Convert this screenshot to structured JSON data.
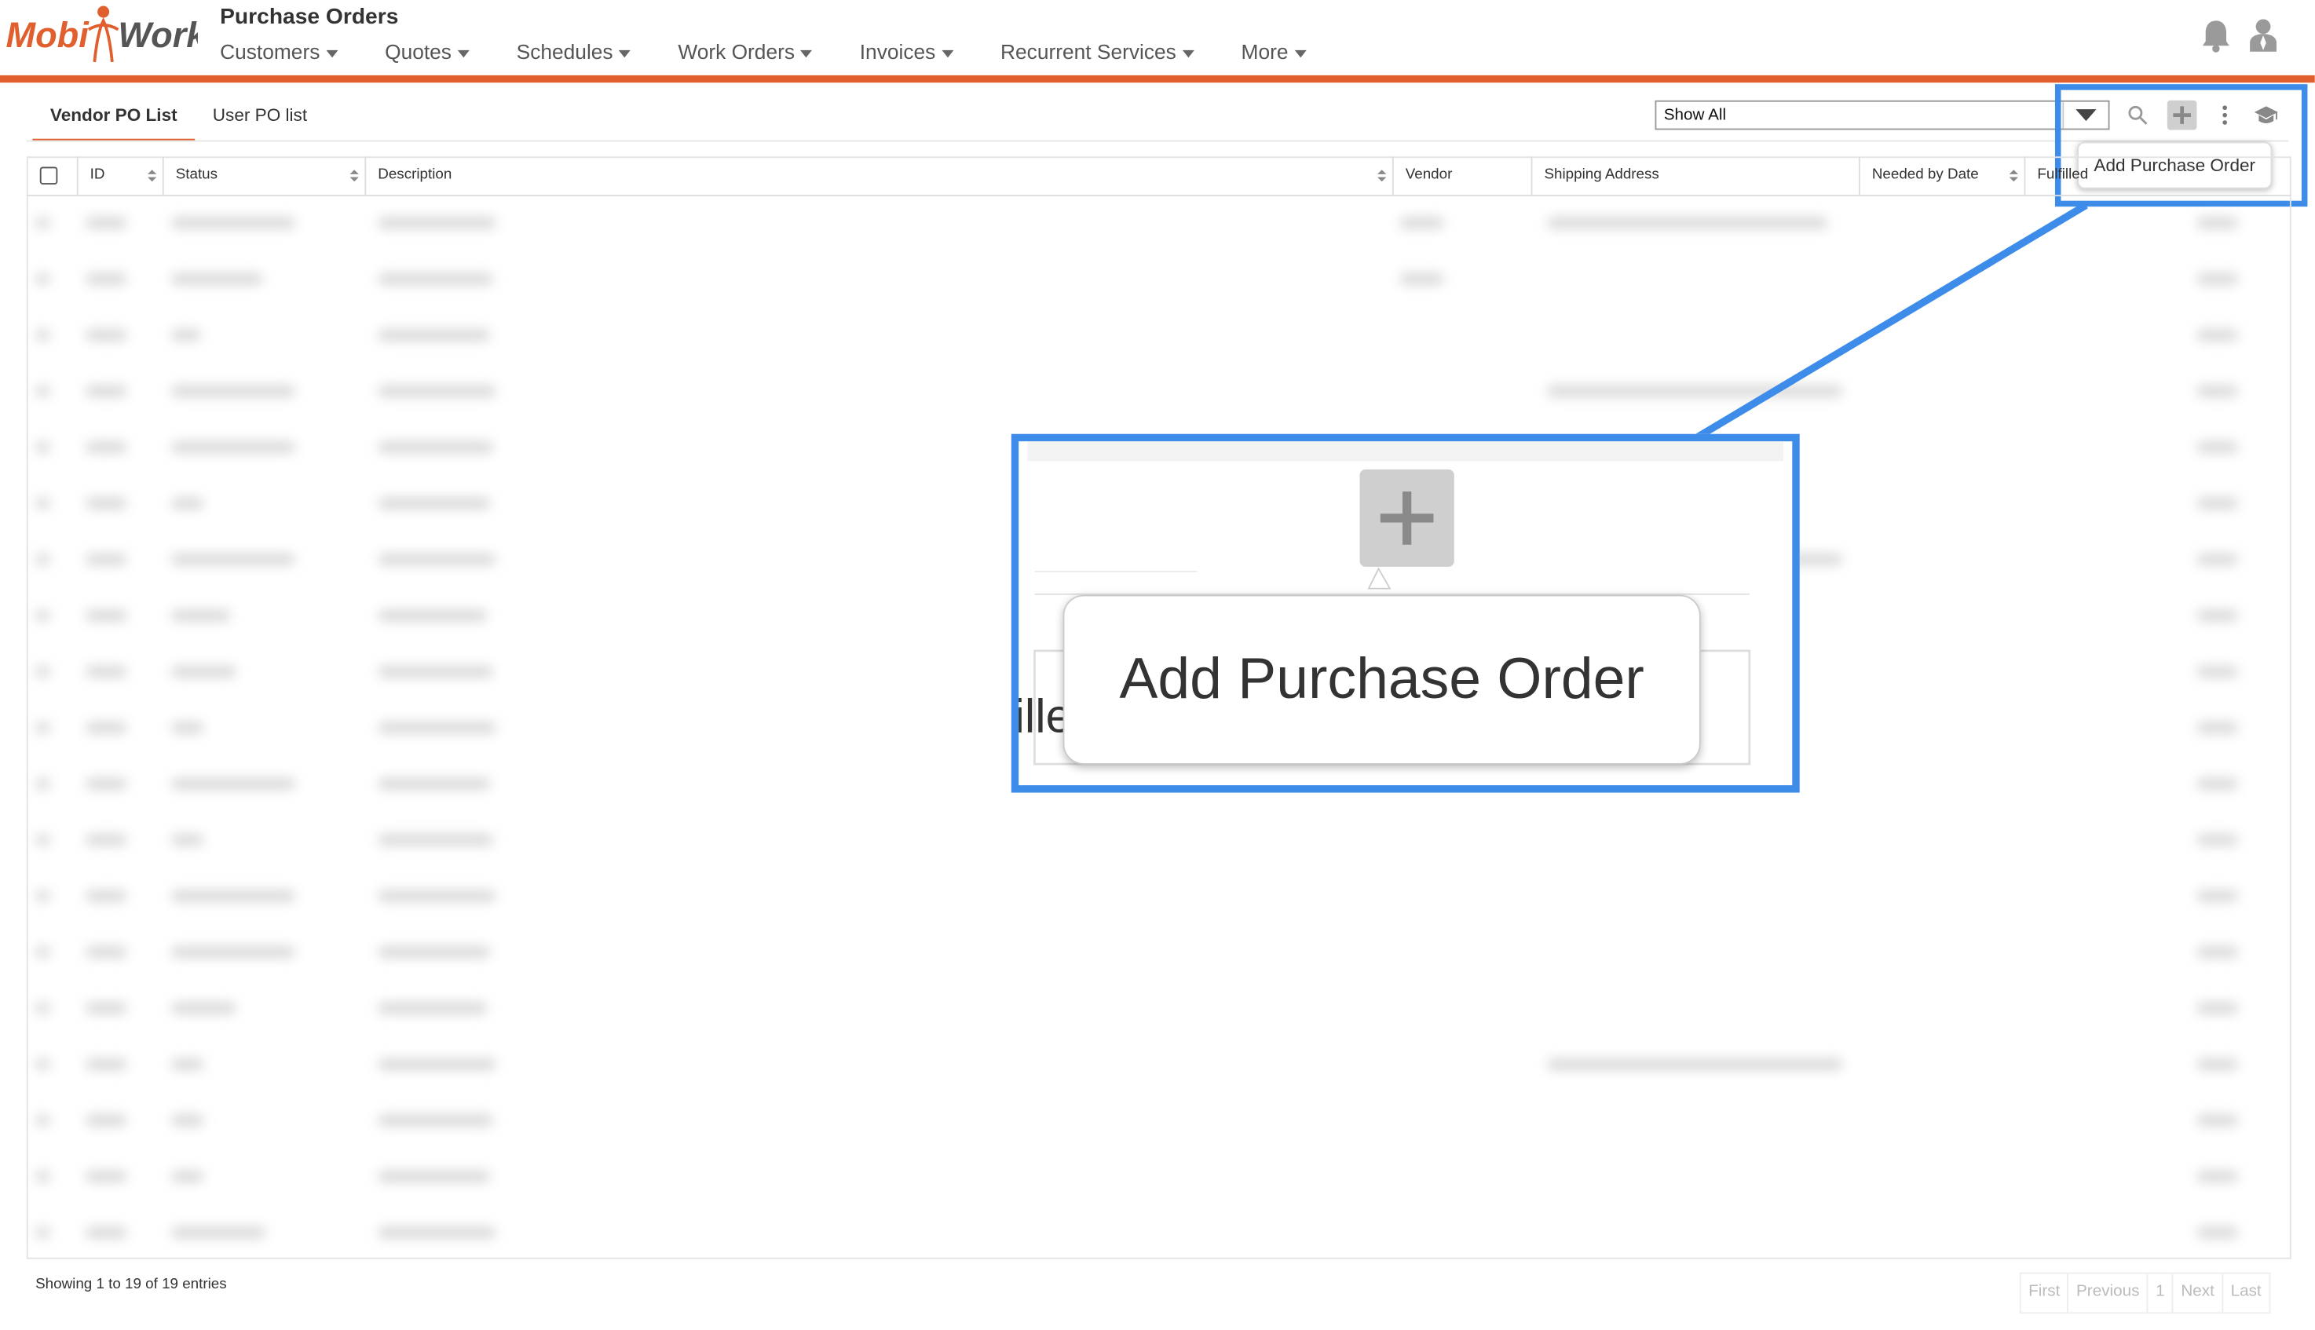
{
  "app": {
    "logo_text": "MobiWork",
    "page_title": "Purchase Orders"
  },
  "nav": [
    {
      "label": "Customers"
    },
    {
      "label": "Quotes"
    },
    {
      "label": "Schedules"
    },
    {
      "label": "Work Orders"
    },
    {
      "label": "Invoices"
    },
    {
      "label": "Recurrent Services"
    },
    {
      "label": "More"
    }
  ],
  "header_icons": [
    "bell-icon",
    "user-icon"
  ],
  "tabs": [
    {
      "label": "Vendor PO List",
      "active": true
    },
    {
      "label": "User PO list",
      "active": false
    }
  ],
  "filter": {
    "selected": "Show All"
  },
  "toolbar": {
    "icons": [
      "search-icon",
      "plus-icon",
      "more-vertical-icon",
      "graduation-cap-icon"
    ],
    "tooltip": "Add Purchase Order"
  },
  "table": {
    "columns": [
      "ID",
      "Status",
      "Description",
      "Vendor",
      "Shipping Address",
      "Needed by Date",
      "Fulfilled"
    ],
    "row_count": 19
  },
  "zoom": {
    "tooltip": "Add Purchase Order",
    "partial_text": "ille"
  },
  "footer": {
    "info": "Showing 1 to 19 of 19 entries",
    "pager": [
      "First",
      "Previous",
      "1",
      "Next",
      "Last"
    ]
  },
  "colors": {
    "accent": "#e15f2e",
    "highlight": "#3d8ce9"
  }
}
